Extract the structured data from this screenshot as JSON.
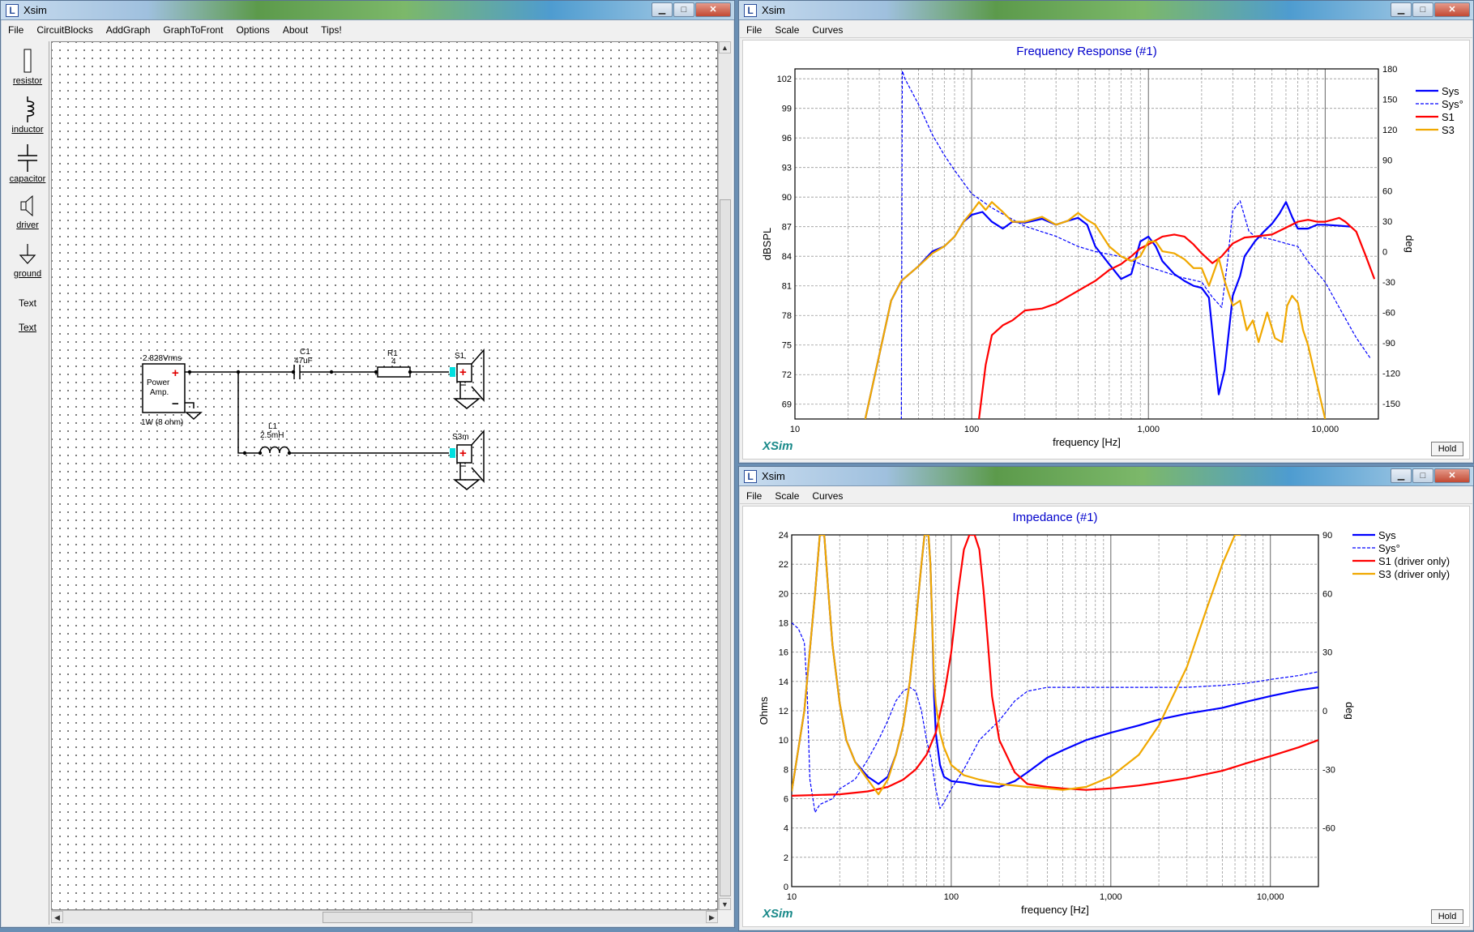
{
  "schematic": {
    "title": "Xsim",
    "menu": [
      "File",
      "CircuitBlocks",
      "AddGraph",
      "GraphToFront",
      "Options",
      "About",
      "Tips!"
    ],
    "tools": [
      {
        "label": "resistor",
        "icon": "resistor-icon"
      },
      {
        "label": "inductor",
        "icon": "inductor-icon"
      },
      {
        "label": "capacitor",
        "icon": "capacitor-icon"
      },
      {
        "label": "driver",
        "icon": "driver-icon"
      },
      {
        "label": "ground",
        "icon": "ground-icon"
      },
      {
        "label": "Text",
        "icon": "text-icon"
      },
      {
        "label": "Text",
        "icon": "text-icon"
      }
    ],
    "amp": {
      "voltage": "2.828Vrms",
      "name1": "Power",
      "name2": "Amp.",
      "plus": "+",
      "minus": "−",
      "note": "1W (8 ohm)"
    },
    "c1": {
      "name": "C1",
      "value": "47uF"
    },
    "r1": {
      "name": "R1",
      "value": "4"
    },
    "l1": {
      "name": "L1",
      "value": "2.5mH"
    },
    "s1": {
      "name": "S1"
    },
    "s3": {
      "name": "S3m"
    }
  },
  "response": {
    "title": "Xsim",
    "menu": [
      "File",
      "Scale",
      "Curves"
    ],
    "hold": "Hold",
    "brand": "XSim",
    "chart_data": {
      "type": "line",
      "title": "Frequency Response (#1)",
      "xlabel": "frequency [Hz]",
      "ylabel": "dBSPL",
      "y2label": "deg",
      "xscale": "log",
      "xlim": [
        10,
        20000
      ],
      "ylim": [
        67.5,
        103
      ],
      "y2lim": [
        -165,
        180
      ],
      "xticks": [
        "10",
        "100",
        "1,000",
        "10,000"
      ],
      "yticks": [
        "102",
        "99",
        "96",
        "93",
        "90",
        "87",
        "84",
        "81",
        "78",
        "75",
        "72",
        "69"
      ],
      "y2ticks": [
        "180",
        "150",
        "120",
        "90",
        "60",
        "30",
        "0",
        "-30",
        "-60",
        "-90",
        "-120",
        "-150"
      ],
      "legend_position": "top-right",
      "series": [
        {
          "name": "Sys",
          "color": "#0000ff",
          "style": "solid",
          "width": 2.2,
          "axis": "left",
          "x": [
            25,
            30,
            35,
            40,
            50,
            60,
            70,
            80,
            90,
            100,
            115,
            130,
            150,
            170,
            200,
            250,
            300,
            350,
            400,
            450,
            500,
            600,
            700,
            800,
            900,
            1000,
            1100,
            1200,
            1400,
            1600,
            1800,
            2000,
            2200,
            2500,
            2700,
            3000,
            3300,
            3500,
            4000,
            4500,
            5000,
            5500,
            6000,
            6500,
            7000,
            8000,
            9000,
            10000,
            12000,
            14000
          ],
          "y": [
            67.5,
            74,
            79.5,
            81.5,
            83,
            84.5,
            85,
            86,
            87.5,
            88.2,
            88.5,
            87.5,
            86.8,
            87.5,
            87.4,
            87.8,
            87.2,
            87.6,
            87.9,
            87.2,
            85,
            83.2,
            81.7,
            82.2,
            85.5,
            86,
            85,
            83.5,
            82.2,
            81.5,
            81,
            80.8,
            79.8,
            70,
            72.5,
            80,
            82,
            84,
            85.5,
            86.5,
            87.3,
            88.3,
            89.5,
            88,
            86.8,
            86.8,
            87.2,
            87.2,
            87.1,
            87
          ]
        },
        {
          "name": "Sys°",
          "color": "#0000ff",
          "style": "dashed",
          "width": 1.2,
          "axis": "right",
          "x": [
            40,
            40.5,
            42,
            50,
            60,
            70,
            80,
            100,
            130,
            150,
            200,
            300,
            400,
            500,
            700,
            1000,
            1500,
            2000,
            2300,
            2600,
            2800,
            3000,
            3300,
            3700,
            4000,
            5000,
            6000,
            7000,
            8000,
            10000,
            12000,
            15000,
            18000
          ],
          "y": [
            -180,
            178,
            170,
            145,
            115,
            95,
            80,
            57,
            43,
            37,
            25,
            15,
            5,
            0,
            -5,
            -15,
            -25,
            -30,
            -45,
            -55,
            -10,
            40,
            50,
            20,
            15,
            12,
            8,
            5,
            -10,
            -30,
            -55,
            -85,
            -105
          ]
        },
        {
          "name": "S1",
          "color": "#ff0000",
          "style": "solid",
          "width": 2.2,
          "axis": "left",
          "x": [
            110,
            120,
            130,
            150,
            170,
            200,
            250,
            300,
            400,
            500,
            600,
            700,
            800,
            900,
            1000,
            1200,
            1400,
            1600,
            1800,
            2000,
            2300,
            2600,
            3000,
            3500,
            4000,
            5000,
            6000,
            7000,
            8000,
            9000,
            10000,
            11000,
            12000,
            13000,
            15000,
            17000,
            19000
          ],
          "y": [
            67.5,
            73,
            76,
            77,
            77.5,
            78.5,
            78.7,
            79.2,
            80.5,
            81.5,
            82.6,
            83.2,
            84,
            84.8,
            85.2,
            86,
            86.2,
            86,
            85.2,
            84.3,
            83.3,
            84,
            85.3,
            85.9,
            86,
            86.2,
            86.9,
            87.5,
            87.7,
            87.5,
            87.5,
            87.7,
            87.9,
            87.5,
            86.5,
            84,
            81.7
          ]
        },
        {
          "name": "S3",
          "color": "#f0a800",
          "style": "solid",
          "width": 2.2,
          "axis": "left",
          "x": [
            25,
            30,
            35,
            40,
            50,
            60,
            70,
            80,
            90,
            100,
            110,
            120,
            130,
            150,
            170,
            200,
            250,
            300,
            350,
            400,
            450,
            500,
            600,
            700,
            800,
            900,
            1000,
            1100,
            1200,
            1400,
            1600,
            1800,
            2000,
            2200,
            2500,
            2700,
            3000,
            3300,
            3600,
            3900,
            4200,
            4700,
            5200,
            5700,
            6100,
            6500,
            7000,
            7500,
            8000,
            9000,
            10000
          ],
          "y": [
            67.5,
            74,
            79.5,
            81.5,
            83,
            84.3,
            85,
            86,
            87.5,
            88.5,
            89.5,
            88.7,
            89.5,
            88.5,
            87.5,
            87.5,
            88,
            87.2,
            87.6,
            88.4,
            87.7,
            87.2,
            85,
            84,
            83.5,
            84,
            85.5,
            85.5,
            84.5,
            84.3,
            83.7,
            82.8,
            82.8,
            81,
            83.8,
            81.5,
            79,
            79.5,
            76.5,
            77.5,
            75.3,
            78.3,
            75.7,
            75.3,
            79,
            80,
            79.3,
            76.5,
            75,
            71,
            67.5
          ]
        }
      ]
    }
  },
  "impedance": {
    "title": "Xsim",
    "menu": [
      "File",
      "Scale",
      "Curves"
    ],
    "hold": "Hold",
    "brand": "XSim",
    "chart_data": {
      "type": "line",
      "title": "Impedance (#1)",
      "xlabel": "frequency [Hz]",
      "ylabel": "Ohms",
      "y2label": "deg",
      "xscale": "log",
      "xlim": [
        10,
        20000
      ],
      "ylim": [
        0,
        24
      ],
      "y2lim": [
        -90,
        90
      ],
      "xticks": [
        "10",
        "100",
        "1,000",
        "10,000"
      ],
      "yticks": [
        "0",
        "2",
        "4",
        "6",
        "8",
        "10",
        "12",
        "14",
        "16",
        "18",
        "20",
        "22",
        "24"
      ],
      "y2ticks": [
        "90",
        "60",
        "30",
        "0",
        "-30",
        "-60"
      ],
      "legend_position": "top-right",
      "series": [
        {
          "name": "Sys",
          "color": "#0000ff",
          "style": "solid",
          "width": 2.2,
          "axis": "left",
          "x": [
            10,
            12,
            14,
            15,
            16,
            17,
            18,
            20,
            22,
            25,
            30,
            35,
            40,
            45,
            50,
            55,
            60,
            65,
            68,
            70,
            72,
            74,
            76,
            78,
            80,
            85,
            90,
            100,
            120,
            150,
            200,
            250,
            300,
            400,
            500,
            700,
            1000,
            1500,
            2000,
            3000,
            5000,
            7000,
            10000,
            15000,
            20000
          ],
          "y": [
            6.5,
            12,
            20,
            24,
            24,
            20,
            16.5,
            12.5,
            10,
            8.5,
            7.5,
            7,
            7.5,
            9,
            11,
            14,
            18,
            22,
            24,
            24,
            24,
            22,
            18,
            13,
            10.5,
            8.3,
            7.5,
            7.2,
            7.1,
            6.9,
            6.8,
            7.2,
            7.8,
            8.8,
            9.3,
            10,
            10.5,
            11,
            11.4,
            11.8,
            12.2,
            12.6,
            13.0,
            13.4,
            13.6
          ]
        },
        {
          "name": "Sys°",
          "color": "#0000ff",
          "style": "dashed",
          "width": 1.2,
          "axis": "right",
          "x": [
            10,
            11,
            12,
            12.5,
            13,
            14,
            15,
            18,
            20,
            25,
            30,
            35,
            40,
            45,
            50,
            55,
            60,
            65,
            70,
            75,
            80,
            85,
            90,
            100,
            120,
            150,
            200,
            250,
            300,
            400,
            500,
            700,
            1000,
            1500,
            2000,
            3000,
            5000,
            7000,
            10000,
            15000,
            20000
          ],
          "y": [
            45,
            42,
            35,
            10,
            -35,
            -52,
            -48,
            -45,
            -40,
            -35,
            -25,
            -15,
            -5,
            5,
            10,
            12,
            10,
            0,
            -15,
            -25,
            -40,
            -50,
            -47,
            -40,
            -30,
            -15,
            -5,
            5,
            10,
            12,
            12,
            12,
            12,
            12,
            12,
            12,
            13,
            14,
            16,
            18,
            20
          ]
        },
        {
          "name": "S1 (driver only)",
          "color": "#ff0000",
          "style": "solid",
          "width": 2.2,
          "axis": "left",
          "x": [
            10,
            20,
            30,
            40,
            50,
            60,
            70,
            80,
            90,
            100,
            110,
            120,
            130,
            140,
            150,
            160,
            170,
            180,
            200,
            250,
            300,
            400,
            500,
            700,
            1000,
            1500,
            2000,
            3000,
            5000,
            7000,
            10000,
            15000,
            20000
          ],
          "y": [
            6.2,
            6.3,
            6.5,
            6.8,
            7.3,
            8,
            9,
            10.5,
            13,
            16,
            20,
            23,
            24,
            24,
            23,
            20,
            16.5,
            13,
            10,
            7.8,
            7,
            6.8,
            6.7,
            6.6,
            6.7,
            6.9,
            7.1,
            7.4,
            7.9,
            8.4,
            8.9,
            9.5,
            10
          ]
        },
        {
          "name": "S3 (driver only)",
          "color": "#f0a800",
          "style": "solid",
          "width": 2.2,
          "axis": "left",
          "x": [
            10,
            12,
            14,
            15,
            16,
            17,
            18,
            20,
            22,
            25,
            30,
            35,
            40,
            45,
            50,
            55,
            60,
            65,
            68,
            70,
            72,
            74,
            76,
            78,
            80,
            85,
            90,
            100,
            120,
            150,
            200,
            300,
            400,
            500,
            700,
            1000,
            1500,
            2000,
            3000,
            4000,
            5000,
            6000,
            6500
          ],
          "y": [
            6.5,
            12,
            20,
            24,
            24,
            20,
            16.5,
            12.5,
            10,
            8.5,
            7.3,
            6.3,
            7.3,
            9,
            11,
            14,
            18,
            22,
            24,
            24,
            24,
            22,
            18,
            14,
            12.5,
            10.5,
            9.5,
            8.3,
            7.6,
            7.3,
            7,
            6.8,
            6.7,
            6.6,
            6.8,
            7.5,
            9,
            11,
            15,
            19,
            22,
            24,
            24
          ]
        }
      ]
    }
  }
}
